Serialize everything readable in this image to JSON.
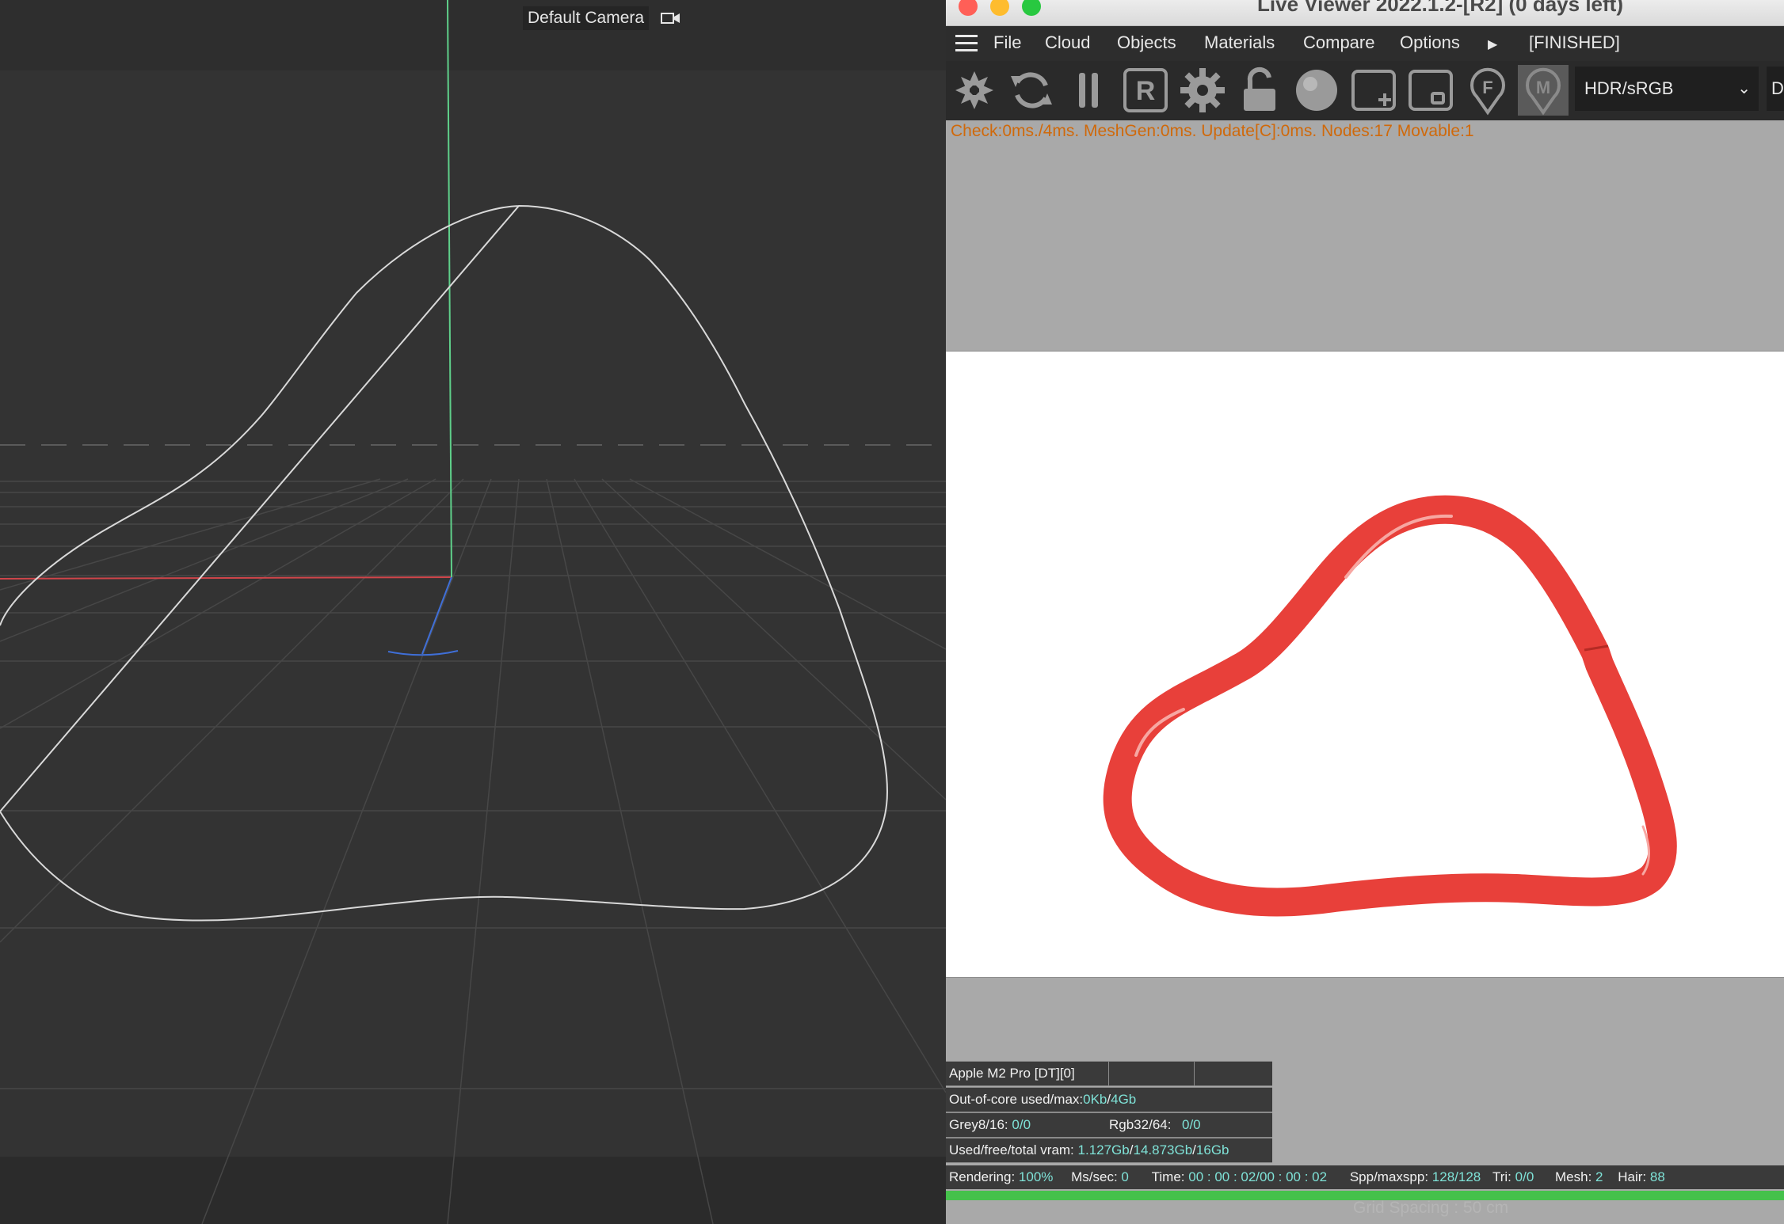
{
  "viewport": {
    "camera_label": "Default Camera",
    "grid_spacing": "Grid Spacing : 50 cm",
    "colors": {
      "background": "#333333",
      "grid": "#4a4a4a",
      "spline": "#d9d9d9",
      "x_axis": "#d0454a",
      "y_axis": "#5fd08a",
      "z_axis": "#3f6fd8"
    }
  },
  "live_viewer": {
    "title": "Live Viewer 2022.1.2-[R2] (0 days left)",
    "menu": [
      "File",
      "Cloud",
      "Objects",
      "Materials",
      "Compare",
      "Options"
    ],
    "menu_more_icon": "triangle-right-icon",
    "status": "[FINISHED]",
    "toolbar_icons": [
      "aperture-icon",
      "refresh-icon",
      "pause-icon",
      "r-icon",
      "gear-icon",
      "lock-icon",
      "sphere-icon",
      "region-add-icon",
      "region-icon",
      "focus-icon",
      "m-icon"
    ],
    "color_space": "HDR/sRGB",
    "second_select": "D",
    "stats": "Check:0ms./4ms. MeshGen:0ms. Update[C]:0ms. Nodes:17 Movable:1",
    "gpu_name": "Apple M2 Pro [DT][0]",
    "out_of_core": {
      "label": "Out-of-core used/max:",
      "used": "0Kb",
      "max": "4Gb"
    },
    "grey": {
      "label": "Grey8/16:",
      "value": "0/0"
    },
    "rgb": {
      "label": "Rgb32/64:",
      "value": "0/0"
    },
    "vram": {
      "label": "Used/free/total vram:",
      "used": "1.127Gb",
      "free": "14.873Gb",
      "total": "16Gb"
    },
    "status_bar": {
      "rendering_label": "Rendering:",
      "rendering": "100%",
      "mssec_label": "Ms/sec:",
      "mssec": "0",
      "time_label": "Time:",
      "time": "00 : 00 : 02/00 : 00 : 02",
      "spp_label": "Spp/maxspp:",
      "spp": "128/128",
      "tri_label": "Tri:",
      "tri": "0/0",
      "mesh_label": "Mesh:",
      "mesh": "2",
      "hair_label": "Hair:",
      "hair": "88"
    },
    "progress": 1.0,
    "colors": {
      "render_background": "#ffffff",
      "object": "#e8403a",
      "progress": "#45c14b",
      "stats_text": "#d0690a",
      "value_text": "#7fe3d8"
    }
  }
}
